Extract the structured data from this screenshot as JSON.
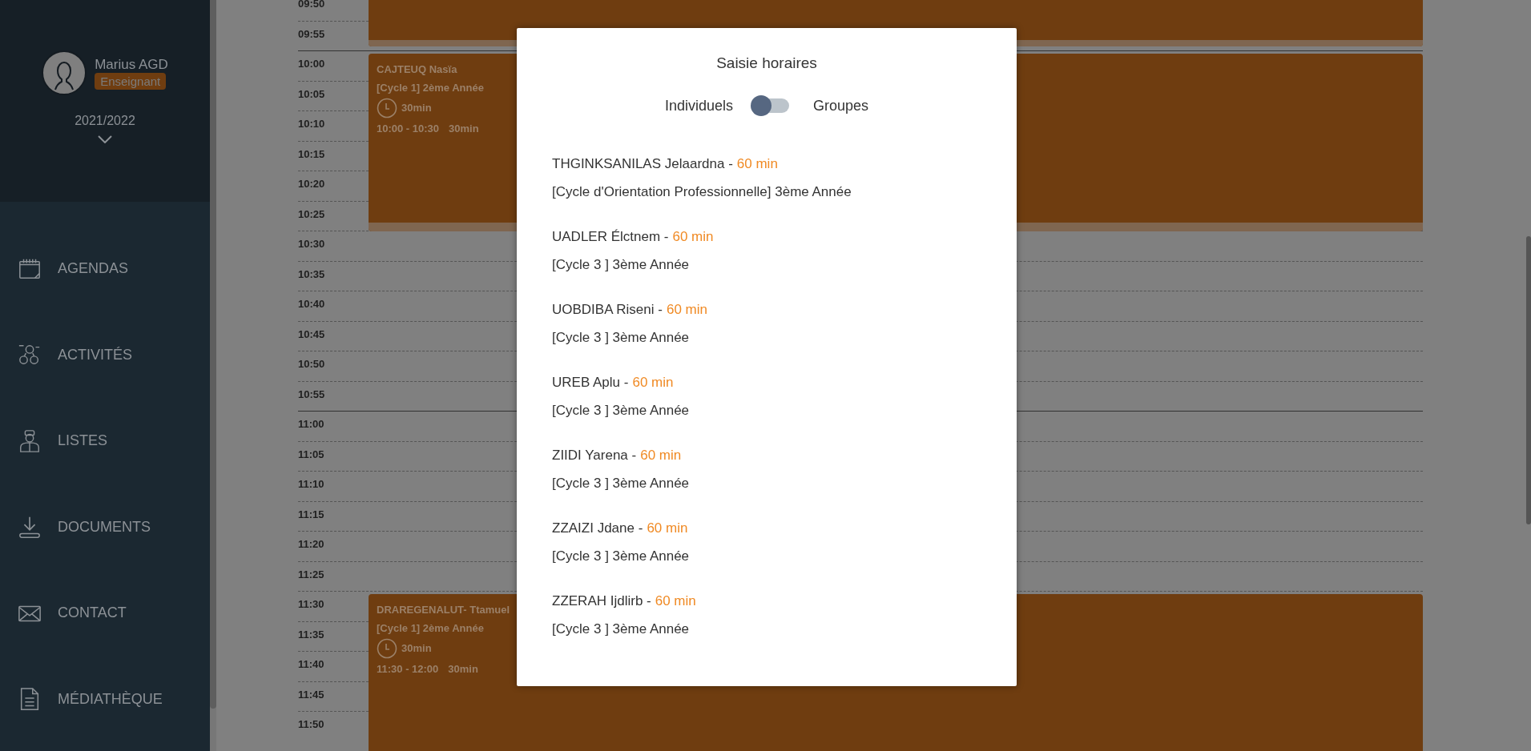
{
  "sidebar": {
    "user": {
      "name": "Marius AGD",
      "role": "Enseignant"
    },
    "year": "2021/2022",
    "items": [
      {
        "label": "AGENDAS"
      },
      {
        "label": "ACTIVITÉS"
      },
      {
        "label": "LISTES"
      },
      {
        "label": "DOCUMENTS"
      },
      {
        "label": "CONTACT"
      },
      {
        "label": "MÉDIATHÈQUE"
      }
    ]
  },
  "calendar": {
    "times": [
      {
        "label": "09:50"
      },
      {
        "label": "09:55"
      },
      {
        "label": "10:00",
        "event": {
          "name": "CAJTEUQ Nasïa",
          "class": "[Cycle 1] 2ème Année",
          "duration": "30min",
          "range": "10:00 - 10:30",
          "range_duration": "30min"
        }
      },
      {
        "label": "10:05"
      },
      {
        "label": "10:10"
      },
      {
        "label": "10:15"
      },
      {
        "label": "10:20"
      },
      {
        "label": "10:25"
      },
      {
        "label": "10:30"
      },
      {
        "label": "10:35"
      },
      {
        "label": "10:40"
      },
      {
        "label": "10:45"
      },
      {
        "label": "10:50"
      },
      {
        "label": "10:55"
      },
      {
        "label": "11:00"
      },
      {
        "label": "11:05"
      },
      {
        "label": "11:10"
      },
      {
        "label": "11:15"
      },
      {
        "label": "11:20"
      },
      {
        "label": "11:25"
      },
      {
        "label": "11:30",
        "event": {
          "name": "DRAREGENALUT- Ttamuel",
          "class": "[Cycle 1] 2ème Année",
          "duration": "30min",
          "range": "11:30 - 12:00",
          "range_duration": "30min"
        }
      },
      {
        "label": "11:35"
      },
      {
        "label": "11:40"
      },
      {
        "label": "11:45"
      },
      {
        "label": "11:50"
      }
    ]
  },
  "modal": {
    "title": "Saisie horaires",
    "toggle": {
      "left_label": "Individuels",
      "right_label": "Groupes",
      "on": false
    },
    "entries": [
      {
        "name": "THGINKSANILAS Jelaardna -",
        "duration": "60 min",
        "class": "[Cycle d'Orientation Professionnelle] 3ème Année"
      },
      {
        "name": "UADLER Élctnem -",
        "duration": "60 min",
        "class": "[Cycle 3 ] 3ème Année"
      },
      {
        "name": "UOBDIBA Riseni -",
        "duration": "60 min",
        "class": "[Cycle 3 ] 3ème Année"
      },
      {
        "name": "UREB Aplu -",
        "duration": "60 min",
        "class": "[Cycle 3 ] 3ème Année"
      },
      {
        "name": "ZIIDI Yarena -",
        "duration": "60 min",
        "class": "[Cycle 3 ] 3ème Année"
      },
      {
        "name": "ZZAIZI Jdane -",
        "duration": "60 min",
        "class": "[Cycle 3 ] 3ème Année"
      },
      {
        "name": "ZZERAH Ijdlirb -",
        "duration": "60 min",
        "class": "[Cycle 3 ] 3ème Année"
      }
    ]
  }
}
